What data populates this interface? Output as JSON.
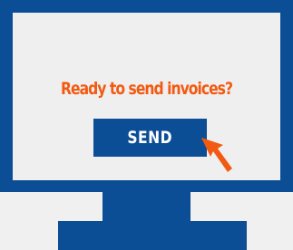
{
  "dialog": {
    "prompt": "Ready to send invoices?",
    "send_label": "SEND"
  },
  "colors": {
    "monitor": "#0c4e96",
    "screen": "#efefef",
    "background": "#f0f0f0",
    "prompt_text": "#f25a12",
    "button": "#0c4e96",
    "button_text": "#ffffff",
    "cursor": "#f25a12"
  },
  "icons": {
    "cursor": "mouse-pointer-arrow-icon"
  }
}
